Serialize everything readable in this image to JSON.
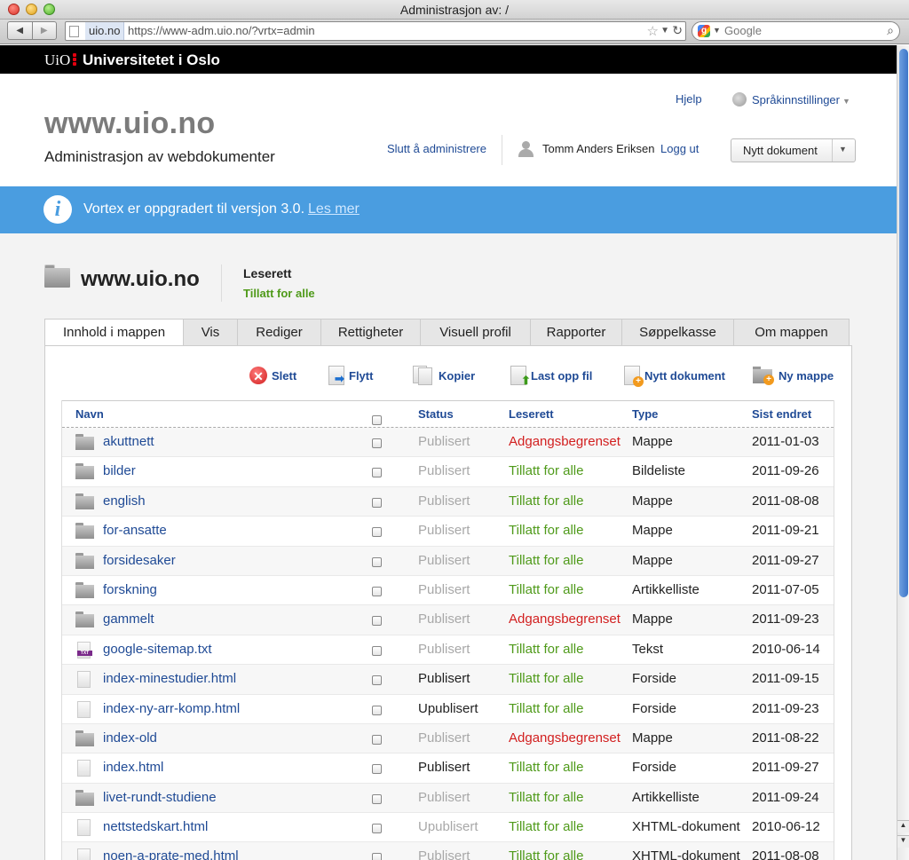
{
  "window": {
    "title": "Administrasjon av: /"
  },
  "browser": {
    "url_domain": "uio.no",
    "url": "https://www-adm.uio.no/?vrtx=admin",
    "search_placeholder": "Google"
  },
  "uio": {
    "logo": "UiO",
    "name": "Universitetet i Oslo"
  },
  "header": {
    "site_title": "www.uio.no",
    "subtitle": "Administrasjon av webdokumenter",
    "help": "Hjelp",
    "language": "Språkinnstillinger",
    "stop_admin": "Slutt å administrere",
    "user": "Tomm Anders Eriksen",
    "logout": "Logg ut",
    "new_doc_button": "Nytt dokument"
  },
  "banner": {
    "text": "Vortex er oppgradert til versjon 3.0.",
    "link": "Les mer"
  },
  "folder": {
    "title": "www.uio.no",
    "access_label": "Leserett",
    "access_value": "Tillatt for alle"
  },
  "tabs": [
    {
      "label": "Innhold i mappen",
      "active": true
    },
    {
      "label": "Vis"
    },
    {
      "label": "Rediger"
    },
    {
      "label": "Rettigheter"
    },
    {
      "label": "Visuell profil"
    },
    {
      "label": "Rapporter"
    },
    {
      "label": "Søppelkasse"
    },
    {
      "label": "Om mappen"
    }
  ],
  "actions": {
    "delete": "Slett",
    "move": "Flytt",
    "copy": "Kopier",
    "upload": "Last opp fil",
    "new_document": "Nytt dokument",
    "new_folder": "Ny mappe"
  },
  "table": {
    "headers": {
      "name": "Navn",
      "status": "Status",
      "access": "Leserett",
      "type": "Type",
      "modified": "Sist endret"
    },
    "rows": [
      {
        "icon": "folder",
        "name": "akuttnett",
        "status": "Publisert",
        "access": "Adgangsbegrenset",
        "type": "Mappe",
        "date": "2011-01-03"
      },
      {
        "icon": "folder",
        "name": "bilder",
        "status": "Publisert",
        "access": "Tillatt for alle",
        "type": "Bildeliste",
        "date": "2011-09-26"
      },
      {
        "icon": "folder",
        "name": "english",
        "status": "Publisert",
        "access": "Tillatt for alle",
        "type": "Mappe",
        "date": "2011-08-08"
      },
      {
        "icon": "folder",
        "name": "for-ansatte",
        "status": "Publisert",
        "access": "Tillatt for alle",
        "type": "Mappe",
        "date": "2011-09-21"
      },
      {
        "icon": "folder",
        "name": "forsidesaker",
        "status": "Publisert",
        "access": "Tillatt for alle",
        "type": "Mappe",
        "date": "2011-09-27"
      },
      {
        "icon": "folder",
        "name": "forskning",
        "status": "Publisert",
        "access": "Tillatt for alle",
        "type": "Artikkelliste",
        "date": "2011-07-05"
      },
      {
        "icon": "folder",
        "name": "gammelt",
        "status": "Publisert",
        "access": "Adgangsbegrenset",
        "type": "Mappe",
        "date": "2011-09-23"
      },
      {
        "icon": "txt",
        "name": "google-sitemap.txt",
        "status": "Publisert",
        "access": "Tillatt for alle",
        "type": "Tekst",
        "date": "2010-06-14"
      },
      {
        "icon": "file",
        "name": "index-minestudier.html",
        "status": "Publisert",
        "status_dark": true,
        "access": "Tillatt for alle",
        "type": "Forside",
        "date": "2011-09-15"
      },
      {
        "icon": "file",
        "name": "index-ny-arr-komp.html",
        "status": "Upublisert",
        "status_dark": true,
        "access": "Tillatt for alle",
        "type": "Forside",
        "date": "2011-09-23"
      },
      {
        "icon": "folder",
        "name": "index-old",
        "status": "Publisert",
        "access": "Adgangsbegrenset",
        "type": "Mappe",
        "date": "2011-08-22"
      },
      {
        "icon": "file",
        "name": "index.html",
        "status": "Publisert",
        "status_dark": true,
        "access": "Tillatt for alle",
        "type": "Forside",
        "date": "2011-09-27"
      },
      {
        "icon": "folder",
        "name": "livet-rundt-studiene",
        "status": "Publisert",
        "access": "Tillatt for alle",
        "type": "Artikkelliste",
        "date": "2011-09-24"
      },
      {
        "icon": "file",
        "name": "nettstedskart.html",
        "status": "Upublisert",
        "access": "Tillatt for alle",
        "type": "XHTML-dokument",
        "date": "2010-06-12"
      },
      {
        "icon": "file",
        "name": "noen-a-prate-med.html",
        "status": "Publisert",
        "access": "Tillatt for alle",
        "type": "XHTML-dokument",
        "date": "2011-08-08"
      }
    ]
  },
  "colors": {
    "link": "#1f4a95",
    "allowed": "#4f9a1a",
    "restricted": "#d21f1f",
    "banner": "#4a9de0"
  }
}
